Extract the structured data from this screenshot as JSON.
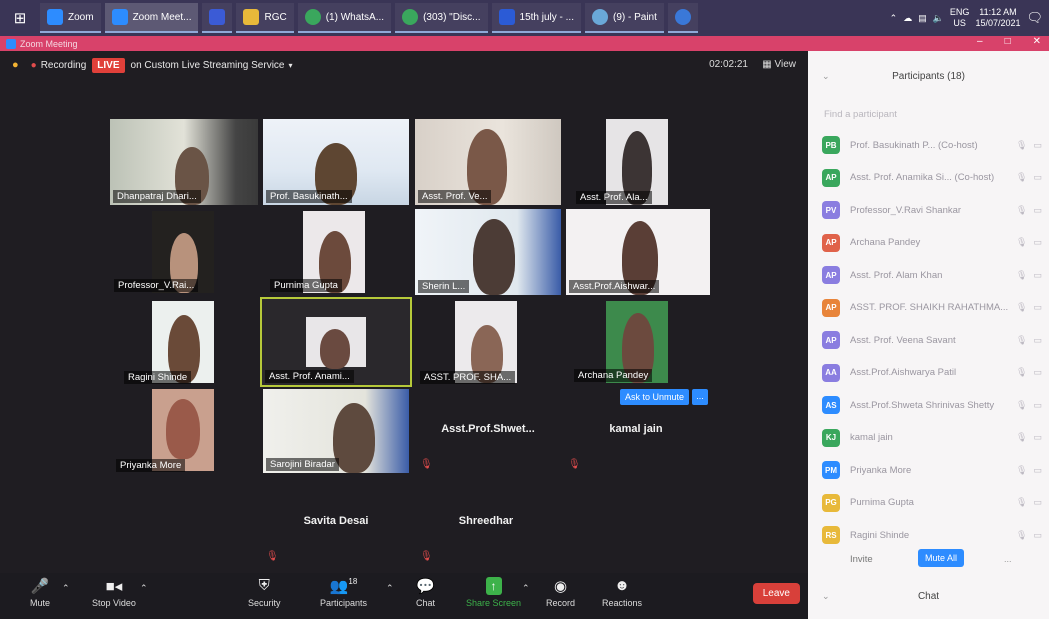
{
  "taskbar": {
    "apps": [
      {
        "label": "Zoom",
        "color": "#2d8cff",
        "active": false
      },
      {
        "label": "Zoom Meet...",
        "color": "#2d8cff",
        "active": true
      },
      {
        "label": "",
        "color": "#3b5bd6",
        "active": false
      },
      {
        "label": "RGC",
        "color": "#e8b93a",
        "active": false
      },
      {
        "label": "(1) WhatsA...",
        "color": "#3aa75d",
        "active": false
      },
      {
        "label": "(303) \"Disc...",
        "color": "#3aa75d",
        "active": false
      },
      {
        "label": "15th july - ...",
        "color": "#2b5bd6",
        "active": false
      },
      {
        "label": "(9) - Paint",
        "color": "#6aa8d8",
        "active": false
      }
    ],
    "lang": "ENG",
    "region": "US",
    "time": "11:12 AM",
    "date": "15/07/2021"
  },
  "window": {
    "title": "Zoom Meeting"
  },
  "meeting": {
    "recording": "Recording",
    "live": "LIVE",
    "streaming": "on Custom Live Streaming Service",
    "timer": "02:02:21",
    "view": "View"
  },
  "tiles": [
    {
      "name": "Dhanpatraj Dhari..."
    },
    {
      "name": "Prof. Basukinath..."
    },
    {
      "name": "Asst. Prof. Ve..."
    },
    {
      "name": "Asst. Prof. Ala..."
    },
    {
      "name": "Professor_V.Rai..."
    },
    {
      "name": "Purnima Gupta"
    },
    {
      "name": "Sherin L..."
    },
    {
      "name": "Asst.Prof.Aishwar..."
    },
    {
      "name": "Ragini Shinde"
    },
    {
      "name": "Asst. Prof. Anami..."
    },
    {
      "name": "ASST. PROF. SHA..."
    },
    {
      "name": "Archana Pandey"
    },
    {
      "name": "Priyanka More"
    },
    {
      "name": "Sarojini Biradar"
    }
  ],
  "name_only": {
    "shwet": "Asst.Prof.Shwet...",
    "kamal": "kamal jain",
    "savita": "Savita Desai",
    "shreedhar": "Shreedhar"
  },
  "ask_unmute": "Ask to Unmute",
  "more": "...",
  "toolbar": {
    "mute": "Mute",
    "stop_video": "Stop Video",
    "security": "Security",
    "participants": "Participants",
    "participants_count": "18",
    "chat": "Chat",
    "share_screen": "Share Screen",
    "record": "Record",
    "reactions": "Reactions",
    "leave": "Leave"
  },
  "panel": {
    "title": "Participants (18)",
    "search_placeholder": "Find a participant",
    "participants": [
      {
        "initials": "PB",
        "name": "Prof. Basukinath P... (Co-host)",
        "color": "#3aa75d"
      },
      {
        "initials": "AP",
        "name": "Asst. Prof. Anamika Si... (Co-host)",
        "color": "#3aa75d"
      },
      {
        "initials": "PV",
        "name": "Professor_V.Ravi Shankar",
        "color": "#8a7de0"
      },
      {
        "initials": "AP",
        "name": "Archana Pandey",
        "color": "#e0624a"
      },
      {
        "initials": "AP",
        "name": "Asst. Prof. Alam Khan",
        "color": "#8a7de0"
      },
      {
        "initials": "AP",
        "name": "ASST. PROF. SHAIKH RAHATHMA...",
        "color": "#e8843a"
      },
      {
        "initials": "AP",
        "name": "Asst. Prof. Veena Savant",
        "color": "#8a7de0"
      },
      {
        "initials": "AA",
        "name": "Asst.Prof.Aishwarya Patil",
        "color": "#8a7de0"
      },
      {
        "initials": "AS",
        "name": "Asst.Prof.Shweta Shrinivas Shetty",
        "color": "#2d8cff"
      },
      {
        "initials": "KJ",
        "name": "kamal jain",
        "color": "#3aa75d"
      },
      {
        "initials": "PM",
        "name": "Priyanka More",
        "color": "#2d8cff"
      },
      {
        "initials": "PG",
        "name": "Purnima Gupta",
        "color": "#e8b93a"
      },
      {
        "initials": "RS",
        "name": "Ragini Shinde",
        "color": "#e8b93a"
      }
    ],
    "invite": "Invite",
    "mute_all": "Mute All",
    "chat": "Chat"
  }
}
